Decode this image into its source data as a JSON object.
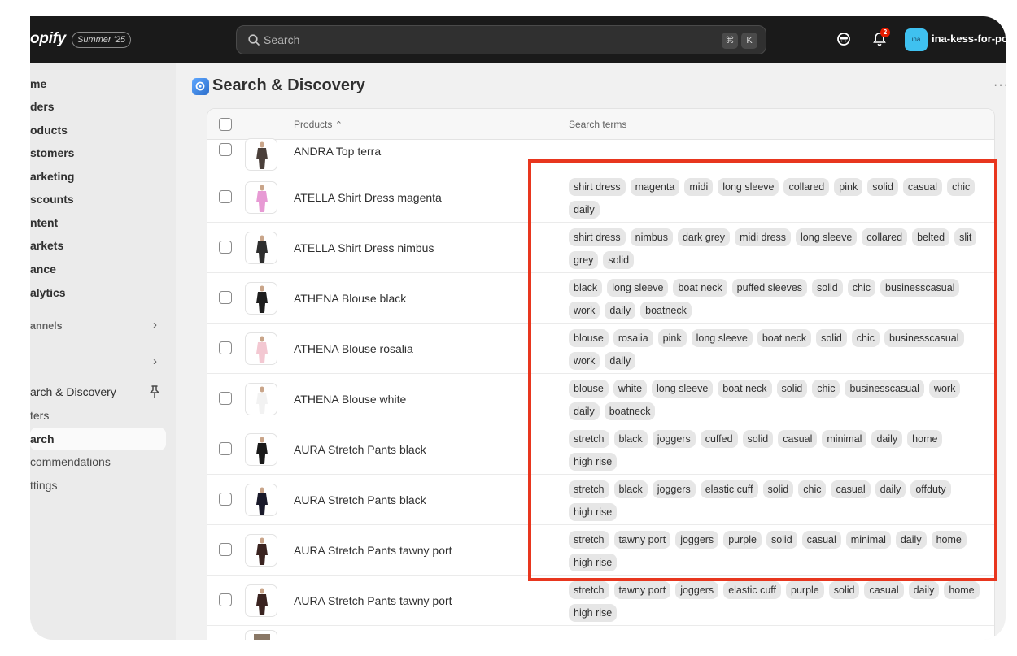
{
  "topbar": {
    "logo_text": "opify",
    "edition": "Summer '25",
    "search_placeholder": "Search",
    "kbd_cmd": "⌘",
    "kbd_k": "K",
    "notification_count": "2",
    "avatar_initials": "ina",
    "store_name": "ina-kess-for-po"
  },
  "sidebar": {
    "items": [
      {
        "label": "me"
      },
      {
        "label": "ders"
      },
      {
        "label": "oducts"
      },
      {
        "label": "stomers"
      },
      {
        "label": "arketing"
      },
      {
        "label": "scounts"
      },
      {
        "label": "ntent"
      },
      {
        "label": "arkets"
      },
      {
        "label": "ance"
      },
      {
        "label": "alytics"
      }
    ],
    "channels_label": "annels",
    "app_label": "arch & Discovery",
    "sub_items": [
      {
        "label": "ters"
      },
      {
        "label": "arch"
      },
      {
        "label": "commendations"
      },
      {
        "label": "ttings"
      }
    ]
  },
  "page": {
    "title": "Search & Discovery",
    "more": "···"
  },
  "table": {
    "headers": {
      "products": "Products",
      "sort_icon": "⌃",
      "search_terms": "Search terms"
    },
    "rows": [
      {
        "name": "ANDRA Top terra",
        "color": "#4a3f3a",
        "tags": []
      },
      {
        "name": "ATELLA Shirt Dress magenta",
        "color": "#e79ad4",
        "tags": [
          "shirt dress",
          "magenta",
          "midi",
          "long sleeve",
          "collared",
          "pink",
          "solid",
          "casual",
          "chic",
          "daily"
        ]
      },
      {
        "name": "ATELLA Shirt Dress nimbus",
        "color": "#2e2e2e",
        "tags": [
          "shirt dress",
          "nimbus",
          "dark grey",
          "midi dress",
          "long sleeve",
          "collared",
          "belted",
          "slit",
          "grey",
          "solid"
        ]
      },
      {
        "name": "ATHENA Blouse black",
        "color": "#1e1e1e",
        "tags": [
          "black",
          "long sleeve",
          "boat neck",
          "puffed sleeves",
          "solid",
          "chic",
          "businesscasual",
          "work",
          "daily",
          "boatneck"
        ]
      },
      {
        "name": "ATHENA Blouse rosalia",
        "color": "#f3c8d2",
        "tags": [
          "blouse",
          "rosalia",
          "pink",
          "long sleeve",
          "boat neck",
          "solid",
          "chic",
          "businesscasual",
          "work",
          "daily"
        ]
      },
      {
        "name": "ATHENA Blouse white",
        "color": "#f2f2f2",
        "tags": [
          "blouse",
          "white",
          "long sleeve",
          "boat neck",
          "solid",
          "chic",
          "businesscasual",
          "work",
          "daily",
          "boatneck"
        ]
      },
      {
        "name": "AURA Stretch Pants black",
        "color": "#1a1a1a",
        "tags": [
          "stretch",
          "black",
          "joggers",
          "cuffed",
          "solid",
          "casual",
          "minimal",
          "daily",
          "home",
          "high rise"
        ]
      },
      {
        "name": "AURA Stretch Pants black",
        "color": "#1a1a2a",
        "tags": [
          "stretch",
          "black",
          "joggers",
          "elastic cuff",
          "solid",
          "chic",
          "casual",
          "daily",
          "offduty",
          "high rise"
        ]
      },
      {
        "name": "AURA Stretch Pants tawny port",
        "color": "#3a2320",
        "tags": [
          "stretch",
          "tawny port",
          "joggers",
          "purple",
          "solid",
          "casual",
          "minimal",
          "daily",
          "home",
          "high rise"
        ]
      },
      {
        "name": "AURA Stretch Pants tawny port",
        "color": "#3a2320",
        "tags": [
          "stretch",
          "tawny port",
          "joggers",
          "elastic cuff",
          "purple",
          "solid",
          "casual",
          "daily",
          "home",
          "high rise"
        ]
      }
    ]
  },
  "colors": {
    "highlight": "#e8361e",
    "accent": "#3fc1f0"
  }
}
